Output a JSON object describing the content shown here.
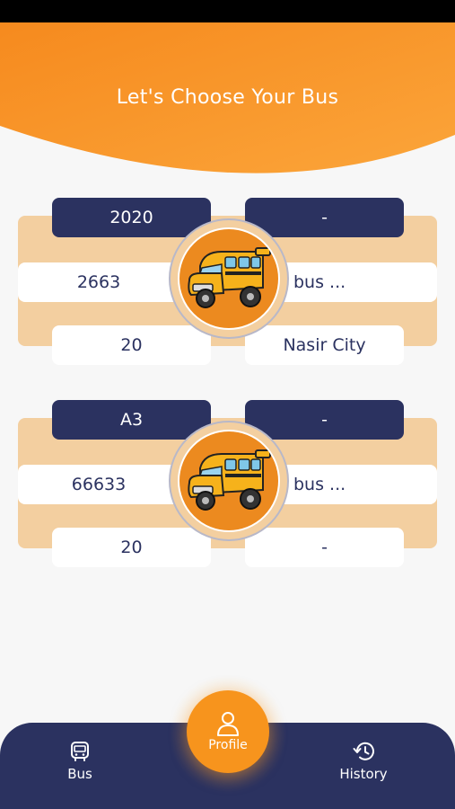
{
  "header": {
    "title": "Let's Choose Your Bus"
  },
  "buses": [
    {
      "top_left": "2020",
      "top_right": "-",
      "mid_left": "2663",
      "mid_right": "bus ...",
      "bottom_left": "20",
      "bottom_right": "Nasir City"
    },
    {
      "top_left": "A3",
      "top_right": "-",
      "mid_left": "66633",
      "mid_right": "bus ...",
      "bottom_left": "20",
      "bottom_right": "-"
    }
  ],
  "nav": {
    "bus_label": "Bus",
    "profile_label": "Profile",
    "history_label": "History"
  },
  "colors": {
    "accent": "#f7941d",
    "navy": "#2b3260",
    "card_band": "#f3cfa0",
    "background": "#f7f7f7"
  },
  "icons": [
    "bus-icon",
    "user-icon",
    "history-icon",
    "school-bus-image"
  ]
}
